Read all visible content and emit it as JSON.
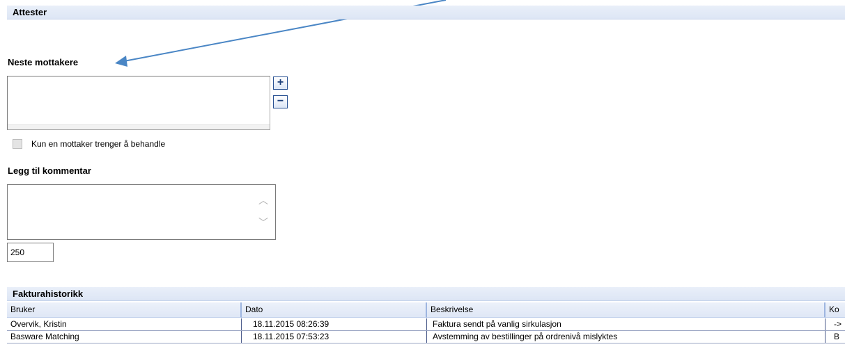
{
  "attester": {
    "title": "Attester"
  },
  "recipients": {
    "label": "Neste mottakere",
    "add_button": "+",
    "remove_button": "−",
    "single_recipient_label": "Kun en mottaker trenger å behandle"
  },
  "comment": {
    "label": "Legg til kommentar",
    "value": "",
    "char_count": "250"
  },
  "history": {
    "title": "Fakturahistorikk",
    "columns": [
      "Bruker",
      "Dato",
      "Beskrivelse",
      "Ko"
    ],
    "rows": [
      [
        "Overvik, Kristin",
        "18.11.2015 08:26:39",
        "Faktura sendt på vanlig sirkulasjon",
        "->"
      ],
      [
        "Basware Matching",
        "18.11.2015 07:53:23",
        "Avstemming av bestillinger på ordrenivå mislyktes",
        "B"
      ]
    ]
  },
  "colors": {
    "header_bg": "#dde6f5",
    "arrow": "#4a86c5",
    "button_border": "#264f91"
  },
  "icons": [
    "plus-icon",
    "minus-icon",
    "scroll-up-icon",
    "scroll-down-icon",
    "annotation-arrow-icon"
  ]
}
